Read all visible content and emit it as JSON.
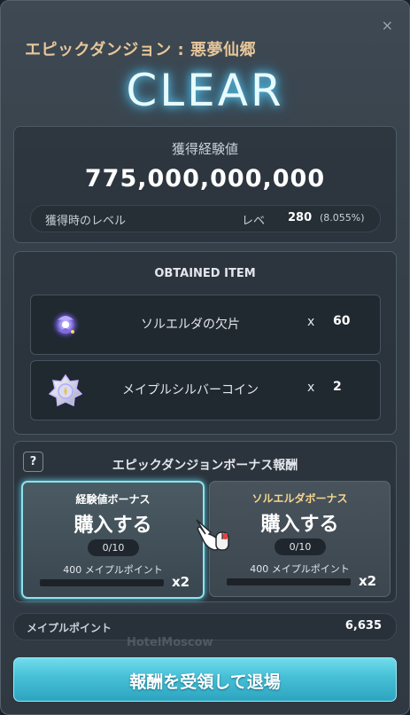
{
  "window": {
    "title": "エピックダンジョン : 悪夢仙郷",
    "banner": "CLEAR",
    "close_icon": "×"
  },
  "experience": {
    "label": "獲得経験値",
    "value": "775,000,000,000",
    "level_label": "獲得時のレベル",
    "level_word": "レベ",
    "level_value": "280",
    "level_percent": "(8.055%)"
  },
  "obtained_items": {
    "heading": "OBTAINED ITEM",
    "items": [
      {
        "name": "ソルエルダの欠片",
        "x": "x",
        "quantity": "60",
        "icon": "sol-erda-fragment-icon"
      },
      {
        "name": "メイプルシルバーコイン",
        "x": "x",
        "quantity": "2",
        "icon": "maple-silver-coin-icon"
      }
    ]
  },
  "bonus": {
    "help": "?",
    "heading": "エピックダンジョンボーナス報酬",
    "cards": [
      {
        "title": "経験値ボーナス",
        "action": "購入する",
        "count": "0/10",
        "cost": "400 メイプルポイント",
        "multiplier": "x2",
        "progress": 0
      },
      {
        "title": "ソルエルダボーナス",
        "action": "購入する",
        "count": "0/10",
        "cost": "400 メイプルポイント",
        "multiplier": "x2",
        "progress": 0
      }
    ]
  },
  "maple_points": {
    "label": "メイプルポイント",
    "value": "6,635"
  },
  "watermark": "HotelMoscow",
  "exit_button": "報酬を受領して退場",
  "colors": {
    "accent_cyan": "#45bfd6",
    "title_gold": "#e7c69a",
    "clear_glow": "#66d3ff"
  }
}
